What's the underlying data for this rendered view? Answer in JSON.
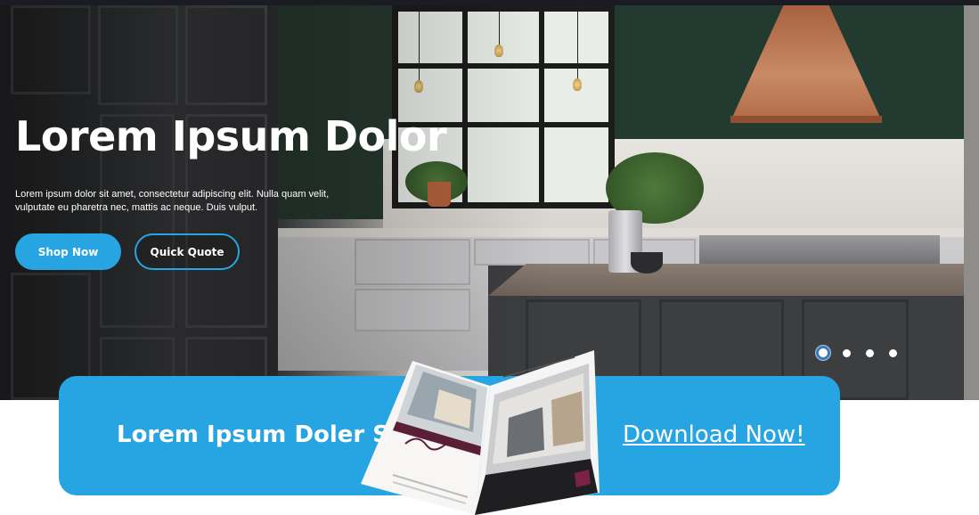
{
  "hero": {
    "title": "Lorem Ipsum Dolor",
    "description": "Lorem ipsum dolor sit amet, consectetur adipiscing elit. Nulla quam velit, vulputate eu pharetra nec, mattis ac neque. Duis vulput.",
    "primary_button": "Shop Now",
    "secondary_button": "Quick Quote",
    "slides": {
      "count": 4,
      "active_index": 1
    }
  },
  "download_banner": {
    "title": "Lorem Ipsum Doler Sit",
    "link_text": "Download Now!"
  },
  "colors": {
    "accent": "#27a5e2",
    "text_on_accent": "#ffffff",
    "active_dot_ring": "#3f7bb5"
  }
}
